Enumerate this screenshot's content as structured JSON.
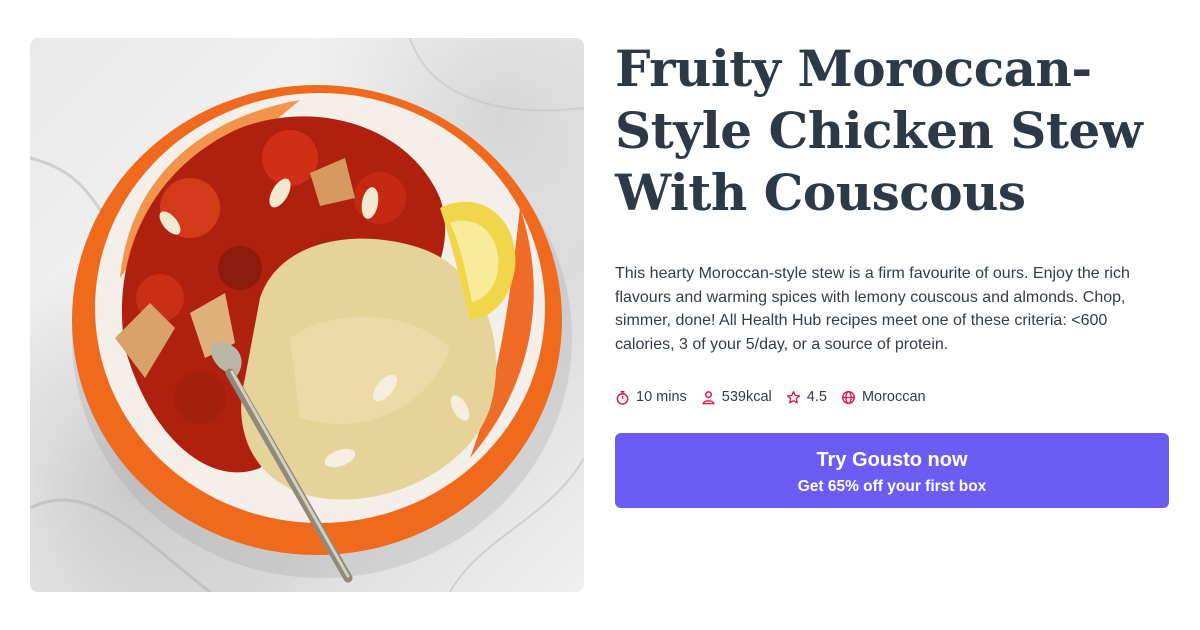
{
  "recipe": {
    "title": "Fruity Moroccan-Style Chicken Stew With Couscous",
    "description": "This hearty Moroccan-style stew is a firm favourite of ours. Enjoy the rich flavours and warming spices with lemony couscous and almonds. Chop, simmer, done! All Health Hub recipes meet one of these criteria: <600 calories, 3 of your 5/day, or a source of protein.",
    "image_icon": "recipe-photo",
    "meta": [
      {
        "icon": "timer-icon",
        "text": "10 mins"
      },
      {
        "icon": "person-icon",
        "text": "539kcal"
      },
      {
        "icon": "star-icon",
        "text": "4.5"
      },
      {
        "icon": "globe-icon",
        "text": "Moroccan"
      }
    ]
  },
  "cta": {
    "main_label": "Try Gousto now",
    "sub_label": "Get 65% off your first box"
  },
  "colors": {
    "accent": "#6a5cf5",
    "title": "#2c3a48",
    "icon": "#e0113e"
  }
}
